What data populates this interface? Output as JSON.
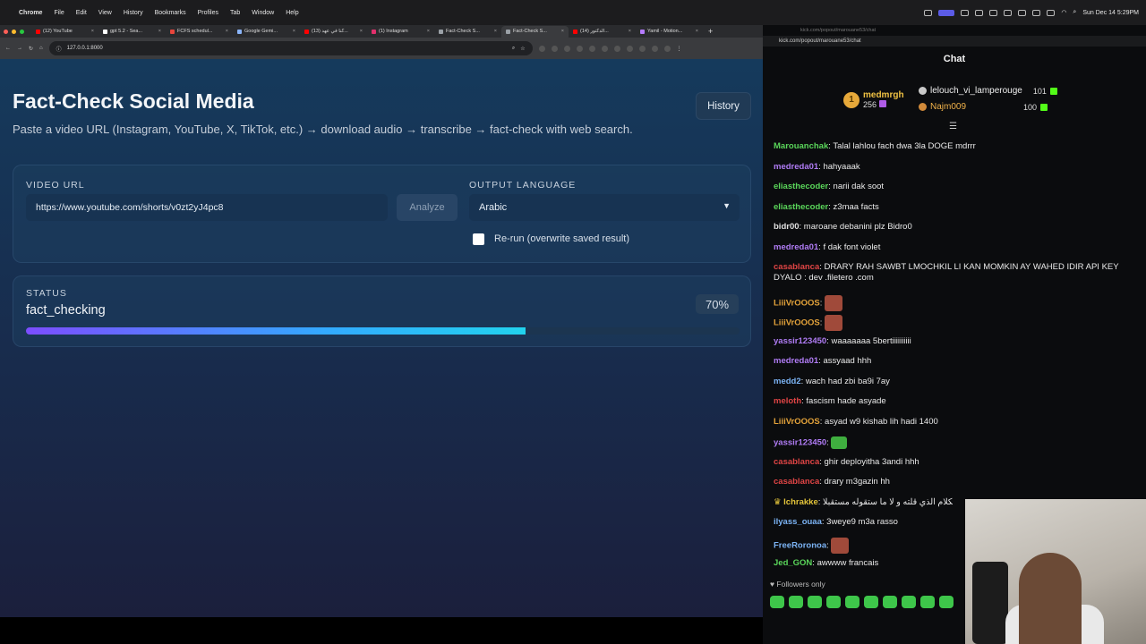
{
  "menubar": {
    "app": "Chrome",
    "items": [
      "File",
      "Edit",
      "View",
      "History",
      "Bookmarks",
      "Profiles",
      "Tab",
      "Window",
      "Help"
    ],
    "clock": "Sun Dec 14 5:29PM"
  },
  "browser": {
    "tabs": [
      {
        "title": "(12) YouTube",
        "color": "#ff0000"
      },
      {
        "title": "gpt 5.2 - Sea...",
        "color": "#ffffff"
      },
      {
        "title": "FCFS schedul...",
        "color": "#e8453c"
      },
      {
        "title": "Google Gemi...",
        "color": "#8ab4f8"
      },
      {
        "title": "(13) كنا في عهد...",
        "color": "#ff0000"
      },
      {
        "title": "(1) Instagram",
        "color": "#e1306c"
      },
      {
        "title": "Fact-Check S...",
        "color": "#9aa0a6"
      },
      {
        "title": "Fact-Check S...",
        "color": "#9aa0a6",
        "active": true
      },
      {
        "title": "(14) الدكتور...",
        "color": "#ff0000"
      },
      {
        "title": "Yamil - Motion...",
        "color": "#b57bff"
      }
    ],
    "url": "127.0.0.1:8000"
  },
  "app": {
    "title": "Fact-Check Social Media",
    "subtitle": "Paste a video URL (Instagram, YouTube, X, TikTok, etc.) → download audio → transcribe → fact-check with web search.",
    "history_label": "History",
    "video_url_label": "VIDEO URL",
    "video_url_value": "https://www.youtube.com/shorts/v0zt2yJ4pc8",
    "analyze_label": "Analyze",
    "output_language_label": "OUTPUT LANGUAGE",
    "output_language_value": "Arabic",
    "rerun_label": "Re-run (overwrite saved result)",
    "status_label": "STATUS",
    "status_value": "fact_checking",
    "progress_text": "70%",
    "progress": 0.7
  },
  "chat": {
    "url_top": "kick.com/popout/marouane53/chat",
    "url": "kick.com/popout/marouane53/chat",
    "title": "Chat",
    "leaderboard": [
      {
        "rank": "1",
        "name": "medmrgh",
        "count": "256"
      },
      {
        "name": "lelouch_vi_lamperouge",
        "count": "101"
      },
      {
        "name": "Najm009",
        "count": "100"
      }
    ],
    "messages": [
      {
        "user": "Marouanchak",
        "color": "#5ad65a",
        "text": "Talal lahlou fach dwa 3la DOGE mdrrr"
      },
      {
        "user": "medreda01",
        "color": "#b07cf5",
        "text": "hahyaaak"
      },
      {
        "user": "eliasthecoder",
        "color": "#5ad65a",
        "text": "narii dak soot"
      },
      {
        "user": "eliasthecoder",
        "color": "#5ad65a",
        "text": "z3maa facts"
      },
      {
        "user": "bidr00",
        "color": "#e0e0e0",
        "text": "maroane debanini plz Bidro0"
      },
      {
        "user": "medreda01",
        "color": "#b07cf5",
        "text": "f dak font violet"
      },
      {
        "user": "casablanca",
        "color": "#e04545",
        "text": "DRARY RAH SAWBT LMOCHKIL LI KAN MOMKIN AY WAHED IDIR API KEY DYALO : dev .filetero .com"
      },
      {
        "user": "LiiiVrOOOS",
        "color": "#e3a23a",
        "text": ""
      },
      {
        "user": "LiiiVrOOOS",
        "color": "#e3a23a",
        "text": ""
      },
      {
        "user": "yassir123450",
        "color": "#b07cf5",
        "text": "waaaaaaa 5bertiiiiiiiiii"
      },
      {
        "user": "medreda01",
        "color": "#b07cf5",
        "text": "assyaad hhh"
      },
      {
        "user": "medd2",
        "color": "#7cb4f5",
        "text": "wach had zbi ba9i 7ay"
      },
      {
        "user": "meloth",
        "color": "#e04545",
        "text": "fascism hade asyade"
      },
      {
        "user": "LiiiVrOOOS",
        "color": "#e3a23a",
        "text": "asyad w9 kishab lih hadi 1400"
      },
      {
        "user": "yassir123450",
        "color": "#b07cf5",
        "text": ""
      },
      {
        "user": "casablanca",
        "color": "#e04545",
        "text": "ghir deployitha 3andi hhh"
      },
      {
        "user": "casablanca",
        "color": "#e04545",
        "text": "drary m3gazin hh"
      },
      {
        "user": "lchrakke",
        "color": "#e3c43a",
        "text": "لا الكلام الذي قلته و لا ما ستقوله مستقبلا"
      },
      {
        "user": "ilyass_ouaa",
        "color": "#7cb4f5",
        "text": "3weye9 m3a rasso"
      },
      {
        "user": "FreeRoronoa",
        "color": "#7cb4f5",
        "text": ""
      },
      {
        "user": "Jed_GON",
        "color": "#5ad65a",
        "text": "awwww francais"
      }
    ],
    "followers_only": "Followers only"
  }
}
